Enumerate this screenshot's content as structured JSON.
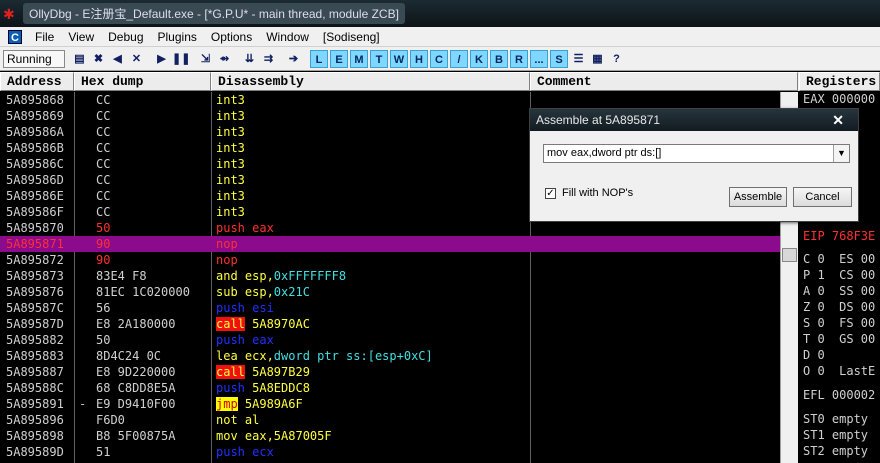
{
  "title": "OllyDbg - E注册宝_Default.exe - [*G.P.U* - main thread, module ZCB]",
  "menu": [
    "File",
    "View",
    "Debug",
    "Plugins",
    "Options",
    "Window",
    "[Sodiseng]"
  ],
  "menu_icon": "C",
  "status": "Running",
  "letter_buttons": [
    "L",
    "E",
    "M",
    "T",
    "W",
    "H",
    "C",
    "/",
    "K",
    "B",
    "R",
    "...",
    "S"
  ],
  "headers": {
    "address": "Address",
    "hex": "Hex dump",
    "disasm": "Disassembly",
    "comment": "Comment",
    "registers": "Registers"
  },
  "rows": [
    {
      "addr": "5A895868",
      "mark": "",
      "hex": "CC",
      "dis": "int3"
    },
    {
      "addr": "5A895869",
      "mark": "",
      "hex": "CC",
      "dis": "int3"
    },
    {
      "addr": "5A89586A",
      "mark": "",
      "hex": "CC",
      "dis": "int3"
    },
    {
      "addr": "5A89586B",
      "mark": "",
      "hex": "CC",
      "dis": "int3"
    },
    {
      "addr": "5A89586C",
      "mark": "",
      "hex": "CC",
      "dis": "int3"
    },
    {
      "addr": "5A89586D",
      "mark": "",
      "hex": "CC",
      "dis": "int3"
    },
    {
      "addr": "5A89586E",
      "mark": "",
      "hex": "CC",
      "dis": "int3"
    },
    {
      "addr": "5A89586F",
      "mark": "",
      "hex": "CC",
      "dis": "int3"
    },
    {
      "addr": "5A895870",
      "mark": "",
      "hex": "50",
      "dis": "push eax"
    },
    {
      "addr": "5A895871",
      "mark": "",
      "hex": "90",
      "dis": "nop"
    },
    {
      "addr": "5A895872",
      "mark": "",
      "hex": "90",
      "dis": "nop"
    },
    {
      "addr": "5A895873",
      "mark": "",
      "hex": "83E4 F8",
      "dis_op": "and esp,",
      "dis_arg": "0xFFFFFFF8"
    },
    {
      "addr": "5A895876",
      "mark": "",
      "hex": "81EC 1C020000",
      "dis_op": "sub esp,",
      "dis_arg": "0x21C"
    },
    {
      "addr": "5A89587C",
      "mark": "",
      "hex": "56",
      "dis": "push esi"
    },
    {
      "addr": "5A89587D",
      "mark": "",
      "hex": "E8 2A180000",
      "dis_op": "call",
      "dis_arg": " 5A8970AC"
    },
    {
      "addr": "5A895882",
      "mark": "",
      "hex": "50",
      "dis": "push eax"
    },
    {
      "addr": "5A895883",
      "mark": "",
      "hex": "8D4C24 0C",
      "dis_op": "lea ecx,",
      "dis_arg": "dword ptr ss:[esp+0xC]"
    },
    {
      "addr": "5A895887",
      "mark": "",
      "hex": "E8 9D220000",
      "dis_op": "call",
      "dis_arg": " 5A897B29"
    },
    {
      "addr": "5A89588C",
      "mark": "",
      "hex": "68 C8DD8E5A",
      "dis_op": "push",
      "dis_arg": " 5A8EDDC8"
    },
    {
      "addr": "5A895891",
      "mark": "-",
      "hex": "E9 D9410F00",
      "dis_op": "jmp",
      "dis_arg": " 5A989A6F"
    },
    {
      "addr": "5A895896",
      "mark": "",
      "hex": "F6D0",
      "dis": "not al"
    },
    {
      "addr": "5A895898",
      "mark": "",
      "hex": "B8 5F00875A",
      "dis": "mov eax,5A87005F"
    },
    {
      "addr": "5A89589D",
      "mark": "",
      "hex": "51",
      "dis": "push ecx"
    }
  ],
  "registers": [
    "EAX 000000",
    "",
    "",
    "",
    "",
    "",
    "",
    "",
    "",
    "EIP 768F3E",
    "",
    "C 0  ES 00",
    "P 1  CS 00",
    "A 0  SS 00",
    "Z 0  DS 00",
    "S 0  FS 00",
    "T 0  GS 00",
    "D 0",
    "O 0  LastE",
    "",
    "EFL 000002",
    "",
    "ST0 empty",
    "ST1 empty",
    "ST2 empty"
  ],
  "dialog": {
    "title": "Assemble at 5A895871",
    "input_value": "mov eax,dword ptr ds:[]",
    "checkbox_label": "Fill with NOP's",
    "assemble": "Assemble",
    "cancel": "Cancel"
  }
}
